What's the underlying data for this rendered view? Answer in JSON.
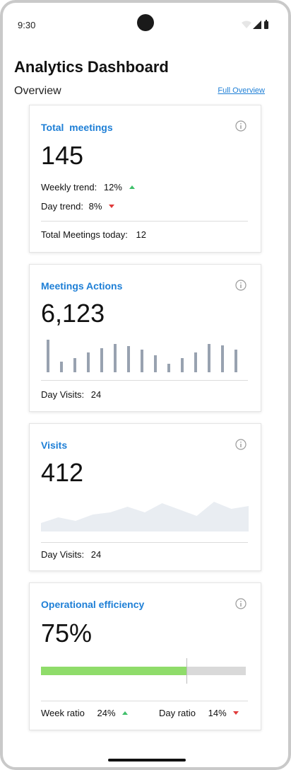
{
  "status": {
    "time": "9:30"
  },
  "header": {
    "title": "Analytics Dashboard",
    "section": "Overview",
    "full_link": "Full Overview"
  },
  "cards": {
    "meetings": {
      "title": "Total  meetings",
      "value": "145",
      "weekly_label": "Weekly trend:",
      "weekly_value": "12%",
      "day_label": "Day trend:",
      "day_value": "8%",
      "today_label": "Total Meetings today:",
      "today_value": "12"
    },
    "actions": {
      "title": "Meetings Actions",
      "value": "6,123",
      "visits_label": "Day Visits:",
      "visits_value": "24",
      "bar_values": [
        46,
        15,
        20,
        28,
        34,
        40,
        37,
        32,
        24,
        12,
        20,
        28,
        40,
        38,
        32
      ]
    },
    "visits": {
      "title": "Visits",
      "value": "412",
      "visits_label": "Day Visits:",
      "visits_value": "24",
      "area_values": [
        12,
        20,
        15,
        24,
        27,
        35,
        27,
        40,
        31,
        22,
        42,
        32,
        36
      ]
    },
    "efficiency": {
      "title": "Operational efficiency",
      "value": "75%",
      "progress": 0.71,
      "target": 0.71,
      "week_label": "Week ratio",
      "week_value": "24%",
      "day_label": "Day ratio",
      "day_value": "14%"
    }
  },
  "colors": {
    "accent": "#1e7fd6",
    "bar": "#98a2b0",
    "area": "#e9edf2",
    "progress": "#8fdc6a",
    "track": "#d9d9d9",
    "up": "#3fbf6a",
    "down": "#e03a3a"
  },
  "icons": [
    "info-icon",
    "wifi-icon",
    "signal-icon",
    "battery-icon",
    "trend-up-icon",
    "trend-down-icon"
  ]
}
